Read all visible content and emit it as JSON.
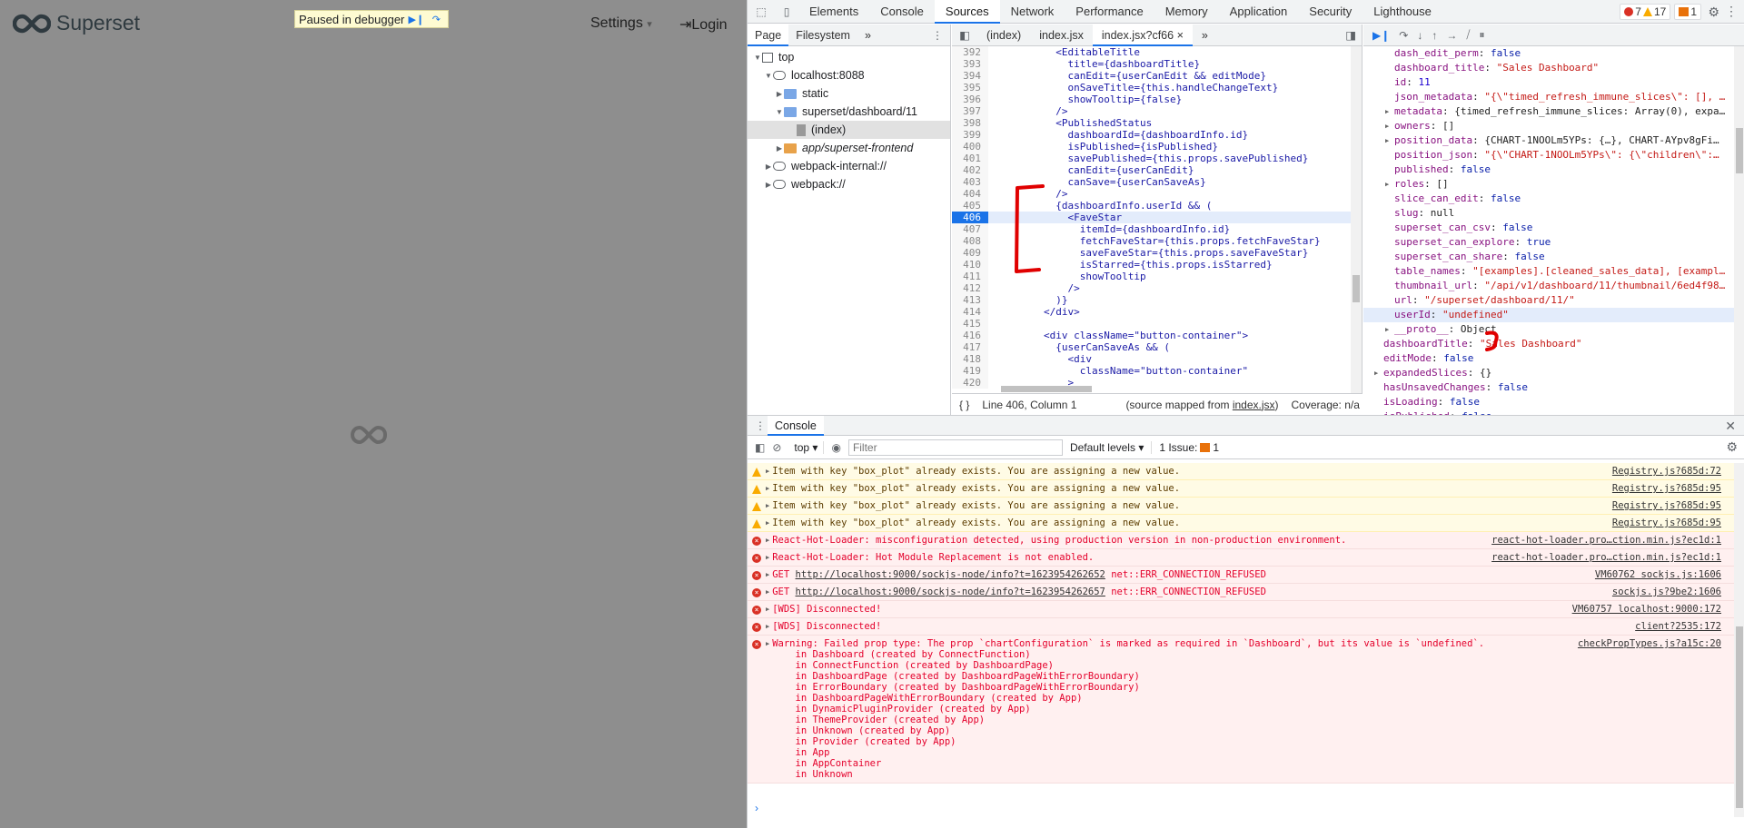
{
  "app": {
    "brand": "Superset",
    "debugger_label": "Paused in debugger",
    "settings_label": "Settings",
    "settings_caret": "▾",
    "login_label": "Login"
  },
  "devtools": {
    "tabs": [
      "Elements",
      "Console",
      "Sources",
      "Network",
      "Performance",
      "Memory",
      "Application",
      "Security",
      "Lighthouse"
    ],
    "active_tab": "Sources",
    "badges": {
      "errors": "7",
      "warnings": "17",
      "issues": "1"
    },
    "navigator": {
      "tabs": [
        "Page",
        "Filesystem"
      ],
      "more": "»",
      "tree": [
        {
          "label": "top",
          "depth": 0,
          "icon": "frame"
        },
        {
          "label": "localhost:8088",
          "depth": 1,
          "icon": "cloud"
        },
        {
          "label": "static",
          "depth": 2,
          "icon": "folder"
        },
        {
          "label": "superset/dashboard/11",
          "depth": 2,
          "icon": "folder"
        },
        {
          "label": "(index)",
          "depth": 3,
          "icon": "file"
        },
        {
          "label": "app/superset-frontend",
          "depth": 2,
          "icon": "folder-orange"
        },
        {
          "label": "webpack-internal://",
          "depth": 1,
          "icon": "cloud"
        },
        {
          "label": "webpack://",
          "depth": 1,
          "icon": "cloud"
        }
      ]
    },
    "editor": {
      "tabs": [
        "(index)",
        "index.jsx",
        "index.jsx?cf66"
      ],
      "more": "»",
      "close": "×",
      "lines": [
        {
          "n": "392",
          "t": "          <EditableTitle"
        },
        {
          "n": "393",
          "t": "            title={dashboardTitle}"
        },
        {
          "n": "394",
          "t": "            canEdit={userCanEdit && editMode}"
        },
        {
          "n": "395",
          "t": "            onSaveTitle={this.handleChangeText}"
        },
        {
          "n": "396",
          "t": "            showTooltip={false}"
        },
        {
          "n": "397",
          "t": "          />"
        },
        {
          "n": "398",
          "t": "          <PublishedStatus"
        },
        {
          "n": "399",
          "t": "            dashboardId={dashboardInfo.id}"
        },
        {
          "n": "400",
          "t": "            isPublished={isPublished}"
        },
        {
          "n": "401",
          "t": "            savePublished={this.props.savePublished}"
        },
        {
          "n": "402",
          "t": "            canEdit={userCanEdit}"
        },
        {
          "n": "403",
          "t": "            canSave={userCanSaveAs}"
        },
        {
          "n": "404",
          "t": "          />"
        },
        {
          "n": "405",
          "t": "          {dashboardInfo.userId && ("
        },
        {
          "n": "406",
          "t": "            <FaveStar"
        },
        {
          "n": "407",
          "t": "              itemId={dashboardInfo.id}"
        },
        {
          "n": "408",
          "t": "              fetchFaveStar={this.props.fetchFaveStar}"
        },
        {
          "n": "409",
          "t": "              saveFaveStar={this.props.saveFaveStar}"
        },
        {
          "n": "410",
          "t": "              isStarred={this.props.isStarred}"
        },
        {
          "n": "411",
          "t": "              showTooltip"
        },
        {
          "n": "412",
          "t": "            />"
        },
        {
          "n": "413",
          "t": "          )}"
        },
        {
          "n": "414",
          "t": "        </div>"
        },
        {
          "n": "415",
          "t": ""
        },
        {
          "n": "416",
          "t": "        <div className=\"button-container\">"
        },
        {
          "n": "417",
          "t": "          {userCanSaveAs && ("
        },
        {
          "n": "418",
          "t": "            <div"
        },
        {
          "n": "419",
          "t": "              className=\"button-container\""
        },
        {
          "n": "420",
          "t": "            >"
        }
      ],
      "current_line": "406",
      "status": {
        "braces": "{ }",
        "position": "Line 406, Column 1",
        "mapped": "(source mapped from ",
        "mapped_file": "index.jsx",
        "mapped_end": ")",
        "coverage": "Coverage: n/a"
      }
    },
    "scope": [
      {
        "d": 1,
        "k": "dash_edit_perm",
        "v": "false",
        "c": "vk",
        "exp": false
      },
      {
        "d": 1,
        "k": "dashboard_title",
        "v": "\"Sales Dashboard\"",
        "c": "vs",
        "exp": false
      },
      {
        "d": 1,
        "k": "id",
        "v": "11",
        "c": "vn",
        "exp": false
      },
      {
        "d": 1,
        "k": "json_metadata",
        "v": "\"{\\\"timed_refresh_immune_slices\\\": [], …",
        "c": "vs",
        "exp": false
      },
      {
        "d": 1,
        "k": "metadata",
        "v": "{timed_refresh_immune_slices: Array(0), expa…",
        "c": "vo",
        "exp": true
      },
      {
        "d": 1,
        "k": "owners",
        "v": "[]",
        "c": "vo",
        "exp": true
      },
      {
        "d": 1,
        "k": "position_data",
        "v": "{CHART-1NOOLm5YPs: {…}, CHART-AYpv8gFi…",
        "c": "vo",
        "exp": true
      },
      {
        "d": 1,
        "k": "position_json",
        "v": "\"{\\\"CHART-1NOOLm5YPs\\\": {\\\"children\\\":…",
        "c": "vs",
        "exp": false
      },
      {
        "d": 1,
        "k": "published",
        "v": "false",
        "c": "vk",
        "exp": false
      },
      {
        "d": 1,
        "k": "roles",
        "v": "[]",
        "c": "vo",
        "exp": true
      },
      {
        "d": 1,
        "k": "slice_can_edit",
        "v": "false",
        "c": "vk",
        "exp": false
      },
      {
        "d": 1,
        "k": "slug",
        "v": "null",
        "c": "vo",
        "exp": false
      },
      {
        "d": 1,
        "k": "superset_can_csv",
        "v": "false",
        "c": "vk",
        "exp": false
      },
      {
        "d": 1,
        "k": "superset_can_explore",
        "v": "true",
        "c": "vk",
        "exp": false
      },
      {
        "d": 1,
        "k": "superset_can_share",
        "v": "false",
        "c": "vk",
        "exp": false
      },
      {
        "d": 1,
        "k": "table_names",
        "v": "\"[examples].[cleaned_sales_data], [exampl…",
        "c": "vs",
        "exp": false
      },
      {
        "d": 1,
        "k": "thumbnail_url",
        "v": "\"/api/v1/dashboard/11/thumbnail/6ed4f98…",
        "c": "vs",
        "exp": false
      },
      {
        "d": 1,
        "k": "url",
        "v": "\"/superset/dashboard/11/\"",
        "c": "vs",
        "exp": false
      },
      {
        "d": 1,
        "k": "userId",
        "v": "\"undefined\"",
        "c": "vs",
        "exp": false,
        "hl": true
      },
      {
        "d": 1,
        "k": "__proto__",
        "v": "Object",
        "c": "vo",
        "exp": true
      },
      {
        "d": 0,
        "k": "dashboardTitle",
        "v": "\"Sales Dashboard\"",
        "c": "vs",
        "exp": false
      },
      {
        "d": 0,
        "k": "editMode",
        "v": "false",
        "c": "vk",
        "exp": false
      },
      {
        "d": 0,
        "k": "expandedSlices",
        "v": "{}",
        "c": "vo",
        "exp": true
      },
      {
        "d": 0,
        "k": "hasUnsavedChanges",
        "v": "false",
        "c": "vk",
        "exp": false
      },
      {
        "d": 0,
        "k": "isLoading",
        "v": "false",
        "c": "vk",
        "exp": false
      },
      {
        "d": 0,
        "k": "isPublished",
        "v": "false",
        "c": "vk",
        "exp": false
      }
    ],
    "console": {
      "title": "Console",
      "context": "top",
      "filter_placeholder": "Filter",
      "levels": "Default levels",
      "issues": "1 Issue:",
      "issues_count": "1",
      "messages": [
        {
          "type": "warn",
          "text": "Item with key \"box_plot\" already exists. You are assigning a new value.",
          "src": "Registry.js?685d:72"
        },
        {
          "type": "warn",
          "text": "Item with key \"box_plot\" already exists. You are assigning a new value.",
          "src": "Registry.js?685d:95"
        },
        {
          "type": "warn",
          "text": "Item with key \"box_plot\" already exists. You are assigning a new value.",
          "src": "Registry.js?685d:95"
        },
        {
          "type": "warn",
          "text": "Item with key \"box_plot\" already exists. You are assigning a new value.",
          "src": "Registry.js?685d:95"
        },
        {
          "type": "err",
          "text": "React-Hot-Loader: misconfiguration detected, using production version in non-production environment.",
          "src": "react-hot-loader.pro…ction.min.js?ec1d:1"
        },
        {
          "type": "err",
          "text": "React-Hot-Loader: Hot Module Replacement is not enabled.",
          "src": "react-hot-loader.pro…ction.min.js?ec1d:1"
        },
        {
          "type": "err",
          "pre": "GET ",
          "link": "http://localhost:9000/sockjs-node/info?t=1623954262652",
          "post": " net::ERR_CONNECTION_REFUSED",
          "src": "VM60762 sockjs.js:1606"
        },
        {
          "type": "err",
          "pre": "GET ",
          "link": "http://localhost:9000/sockjs-node/info?t=1623954262657",
          "post": " net::ERR_CONNECTION_REFUSED",
          "src": "sockjs.js?9be2:1606"
        },
        {
          "type": "err",
          "text": "[WDS] Disconnected!",
          "src": "VM60757 localhost:9000:172"
        },
        {
          "type": "err",
          "text": "[WDS] Disconnected!",
          "src": "client?2535:172"
        },
        {
          "type": "err",
          "text": "Warning: Failed prop type: The prop `chartConfiguration` is marked as required in `Dashboard`, but its value is `undefined`.\n    in Dashboard (created by ConnectFunction)\n    in ConnectFunction (created by DashboardPage)\n    in DashboardPage (created by DashboardPageWithErrorBoundary)\n    in ErrorBoundary (created by DashboardPageWithErrorBoundary)\n    in DashboardPageWithErrorBoundary (created by App)\n    in DynamicPluginProvider (created by App)\n    in ThemeProvider (created by App)\n    in Unknown (created by App)\n    in Provider (created by App)\n    in App\n    in AppContainer\n    in Unknown",
          "src": "checkPropTypes.js?a15c:20"
        }
      ],
      "prompt": "›"
    },
    "annotation_color": "#e00000"
  }
}
